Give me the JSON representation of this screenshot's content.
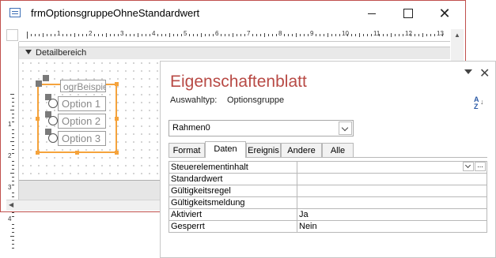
{
  "form_window": {
    "title": "frmOptionsgruppeOhneStandardwert",
    "minimize_icon": "minimize-icon",
    "maximize_icon": "maximize-icon",
    "close_glyph": "✕",
    "section_label": "Detailbereich",
    "ruler_numbers_h": [
      "1",
      "2",
      "3",
      "4",
      "5",
      "6",
      "7",
      "8",
      "9",
      "10",
      "11",
      "12",
      "13"
    ],
    "ruler_numbers_v": [
      "1",
      "2",
      "3",
      "4"
    ]
  },
  "option_group": {
    "label": "ogrBeispiel",
    "options": [
      "Option 1",
      "Option 2",
      "Option 3"
    ]
  },
  "property_sheet": {
    "title": "Eigenschaftenblatt",
    "close_glyph": "✕",
    "selection_type_label": "Auswahltyp:",
    "selection_type_value": "Optionsgruppe",
    "sort_icon_top": "A",
    "sort_icon_bottom": "Z",
    "object_combo_value": "Rahmen0",
    "tabs": [
      "Format",
      "Daten",
      "Ereignis",
      "Andere",
      "Alle"
    ],
    "active_tab": "Daten",
    "build_glyph": "...",
    "properties": [
      {
        "name": "Steuerelementinhalt",
        "value": ""
      },
      {
        "name": "Standardwert",
        "value": ""
      },
      {
        "name": "Gültigkeitsregel",
        "value": ""
      },
      {
        "name": "Gültigkeitsmeldung",
        "value": ""
      },
      {
        "name": "Aktiviert",
        "value": "Ja"
      },
      {
        "name": "Gesperrt",
        "value": "Nein"
      }
    ]
  },
  "colors": {
    "accent": "#b84a45",
    "window_border": "#c0504d",
    "selection": "#f5a33c"
  }
}
